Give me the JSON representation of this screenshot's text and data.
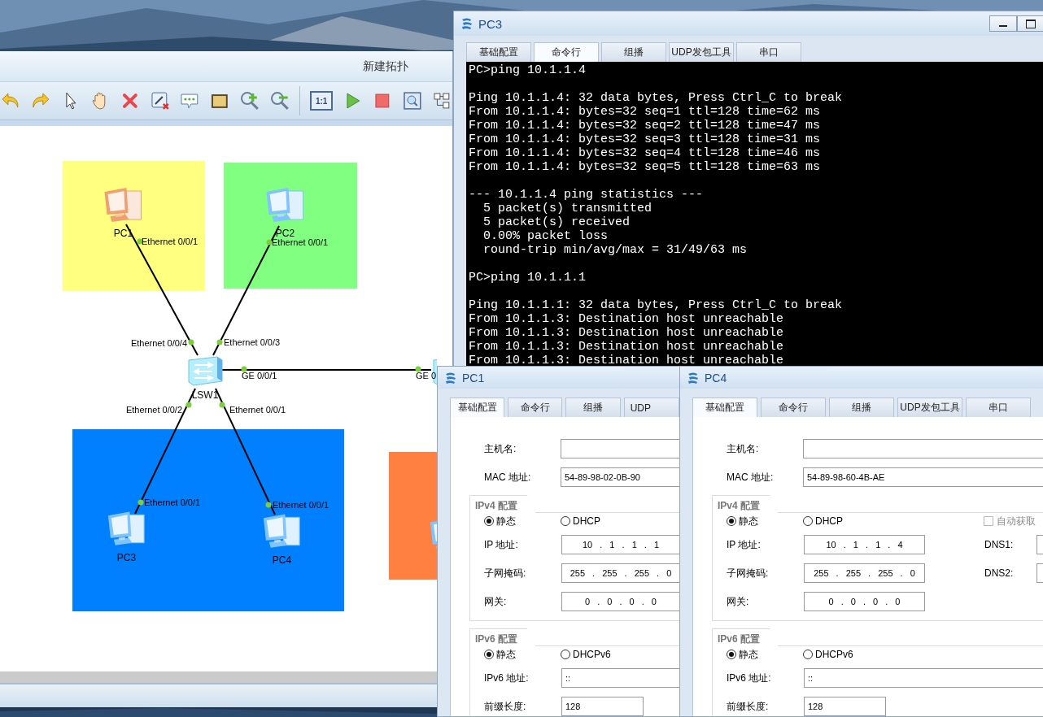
{
  "topology": {
    "title": "新建拓扑",
    "toolbar": [
      {
        "kind": "undo"
      },
      {
        "kind": "redo"
      },
      {
        "kind": "select"
      },
      {
        "kind": "pan"
      },
      {
        "kind": "delete"
      },
      {
        "kind": "delete-link"
      },
      {
        "kind": "comment"
      },
      {
        "kind": "rectangle"
      },
      {
        "kind": "zoom-in"
      },
      {
        "kind": "zoom-out"
      },
      {
        "kind": "separator"
      },
      {
        "kind": "fit",
        "label": "1:1"
      },
      {
        "kind": "start"
      },
      {
        "kind": "stop"
      },
      {
        "kind": "capture"
      },
      {
        "kind": "topology"
      }
    ],
    "areas": [
      {
        "color": "#ffff80"
      },
      {
        "color": "#80ff80"
      },
      {
        "color": "#0080ff"
      },
      {
        "color": "#ff8040"
      }
    ],
    "devices": [
      {
        "kind": "pc",
        "name": "PC1",
        "color": "#f0a070"
      },
      {
        "kind": "pc",
        "name": "PC2",
        "color": "#7fc3ff"
      },
      {
        "kind": "switch",
        "name": "LSW1"
      },
      {
        "kind": "switch"
      },
      {
        "kind": "pc",
        "name": "PC3",
        "color": "#7fc3ff"
      },
      {
        "kind": "pc",
        "name": "PC4",
        "color": "#7fc3ff"
      },
      {
        "kind": "pc",
        "color": "#7fc3ff"
      }
    ],
    "links": [
      {
        "up": true,
        "ends": [
          "Ethernet 0/0/1",
          "Ethernet 0/0/4"
        ]
      },
      {
        "up": true,
        "ends": [
          "Ethernet 0/0/1",
          "Ethernet 0/0/3"
        ]
      },
      {
        "up": true,
        "ends": [
          "GE 0/0/1",
          "GE 0"
        ]
      },
      {
        "up": true,
        "ends": [
          "Ethernet 0/0/2",
          "Ethernet 0/0/1"
        ]
      },
      {
        "up": true,
        "ends": [
          "Ethernet 0/0/1",
          "Ethernet 0/0/1"
        ]
      }
    ]
  },
  "terminal": {
    "title": "PC3",
    "tabs": [
      {
        "label": "基础配置",
        "selected": false
      },
      {
        "label": "命令行",
        "selected": true
      },
      {
        "label": "组播",
        "selected": false
      },
      {
        "label": "UDP发包工具",
        "selected": false
      },
      {
        "label": "串口",
        "selected": false
      }
    ],
    "blocks": [
      [
        "PC>ping 10.1.1.4"
      ],
      [
        "Ping 10.1.1.4: 32 data bytes, Press Ctrl_C to break",
        "From 10.1.1.4: bytes=32 seq=1 ttl=128 time=62 ms",
        "From 10.1.1.4: bytes=32 seq=2 ttl=128 time=47 ms",
        "From 10.1.1.4: bytes=32 seq=3 ttl=128 time=31 ms",
        "From 10.1.1.4: bytes=32 seq=4 ttl=128 time=46 ms",
        "From 10.1.1.4: bytes=32 seq=5 ttl=128 time=63 ms"
      ],
      [
        "--- 10.1.1.4 ping statistics ---",
        "  5 packet(s) transmitted",
        "  5 packet(s) received",
        "  0.00% packet loss",
        "  round-trip min/avg/max = 31/49/63 ms"
      ],
      [
        "PC>ping 10.1.1.1"
      ],
      [
        "Ping 10.1.1.1: 32 data bytes, Press Ctrl_C to break",
        "From 10.1.1.3: Destination host unreachable",
        "From 10.1.1.3: Destination host unreachable",
        "From 10.1.1.3: Destination host unreachable",
        "From 10.1.1.3: Destination host unreachable"
      ]
    ]
  },
  "config_windows": [
    {
      "title": "PC1",
      "tabs": [
        {
          "label": "基础配置",
          "selected": true
        },
        {
          "label": "命令行",
          "selected": false
        },
        {
          "label": "组播",
          "selected": false
        },
        {
          "label": "UDP",
          "selected": false
        }
      ],
      "fields": [
        {
          "label": "主机名:"
        },
        {
          "label": "MAC 地址:",
          "value": "54-89-98-02-0B-90"
        }
      ],
      "ipv4": {
        "legend": "IPv4 配置",
        "modes": [
          {
            "label": "静态",
            "selected": true
          },
          {
            "label": "DHCP",
            "selected": false
          }
        ],
        "fields": [
          {
            "label": "IP 地址:",
            "value": "10 . 1 . 1 . 1"
          },
          {
            "label": "子网掩码:",
            "value": "255 . 255 . 255 . 0"
          },
          {
            "label": "网关:",
            "value": "0 . 0 . 0 . 0"
          }
        ]
      },
      "ipv6": {
        "legend": "IPv6 配置",
        "modes": [
          {
            "label": "静态",
            "selected": true
          },
          {
            "label": "DHCPv6",
            "selected": false
          }
        ],
        "fields": [
          {
            "label": "IPv6 地址:",
            "value": "::"
          },
          {
            "label": "前缀长度:",
            "value": "128"
          }
        ]
      }
    },
    {
      "title": "PC4",
      "tabs": [
        {
          "label": "基础配置",
          "selected": true
        },
        {
          "label": "命令行",
          "selected": false
        },
        {
          "label": "组播",
          "selected": false
        },
        {
          "label": "UDP发包工具",
          "selected": false
        },
        {
          "label": "串口",
          "selected": false
        }
      ],
      "fields": [
        {
          "label": "主机名:"
        },
        {
          "label": "MAC 地址:",
          "value": "54-89-98-60-4B-AE"
        }
      ],
      "ipv4": {
        "legend": "IPv4 配置",
        "modes": [
          {
            "label": "静态",
            "selected": true
          },
          {
            "label": "DHCP",
            "selected": false
          }
        ],
        "auto_dns": {
          "label": "自动获取",
          "checked": false,
          "disabled": true
        },
        "fields": [
          {
            "label": "IP 地址:",
            "value": "10 . 1 . 1 . 4"
          },
          {
            "label": "子网掩码:",
            "value": "255 . 255 . 255 . 0"
          },
          {
            "label": "网关:",
            "value": "0 . 0 . 0 . 0"
          }
        ],
        "dns_fields": [
          {
            "label": "DNS1:"
          },
          {
            "label": "DNS2:"
          }
        ]
      },
      "ipv6": {
        "legend": "IPv6 配置",
        "modes": [
          {
            "label": "静态",
            "selected": true
          },
          {
            "label": "DHCPv6",
            "selected": false
          }
        ],
        "fields": [
          {
            "label": "IPv6 地址:",
            "value": "::"
          },
          {
            "label": "前缀长度:",
            "value": "128"
          }
        ]
      }
    }
  ]
}
